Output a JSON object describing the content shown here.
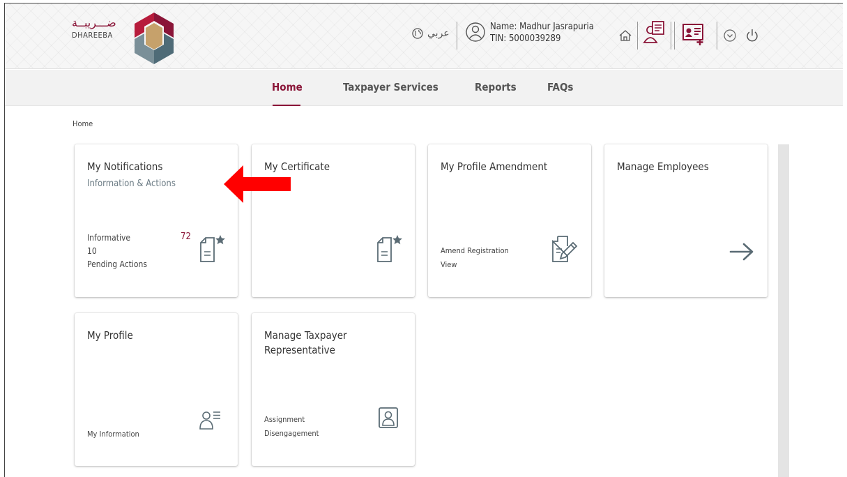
{
  "colors": {
    "accent": "#8a1538",
    "arrow": "#ff0000",
    "icon": "#5a6b74"
  },
  "header": {
    "logo_arabic": "ضـــريبــة",
    "logo_english": "DHAREEBA",
    "language_label": "عربي",
    "user_name": "Name: Madhur Jasrapuria",
    "user_tin": "TIN: 5000039289",
    "icons": [
      "globe-icon",
      "user-icon",
      "home-icon",
      "user-document-icon",
      "id-card-add-icon",
      "chevron-down-circle-icon",
      "power-icon"
    ]
  },
  "nav": {
    "items": [
      {
        "label": "Home",
        "active": true
      },
      {
        "label": "Taxpayer Services",
        "active": false
      },
      {
        "label": "Reports",
        "active": false
      },
      {
        "label": "FAQs",
        "active": false
      }
    ]
  },
  "breadcrumb": "Home",
  "cards": {
    "notifications": {
      "title": "My Notifications",
      "subtitle": "Information & Actions",
      "informative_label": "Informative",
      "informative_count": "72",
      "pending_count": "10",
      "pending_label": "Pending Actions",
      "icon": "document-star-icon"
    },
    "certificate": {
      "title": "My Certificate",
      "icon": "document-star-icon"
    },
    "profile_amendment": {
      "title": "My Profile Amendment",
      "link1": "Amend Registration",
      "link2": "View",
      "icon": "document-edit-icon"
    },
    "manage_employees": {
      "title": "Manage Employees",
      "icon": "arrow-right-icon"
    },
    "my_profile": {
      "title": "My Profile",
      "link1": "My Information",
      "icon": "user-list-icon"
    },
    "taxpayer_rep": {
      "title_line1": "Manage Taxpayer",
      "title_line2": "Representative",
      "link1": "Assignment",
      "link2": "Disengagement",
      "icon": "user-portrait-icon"
    }
  }
}
